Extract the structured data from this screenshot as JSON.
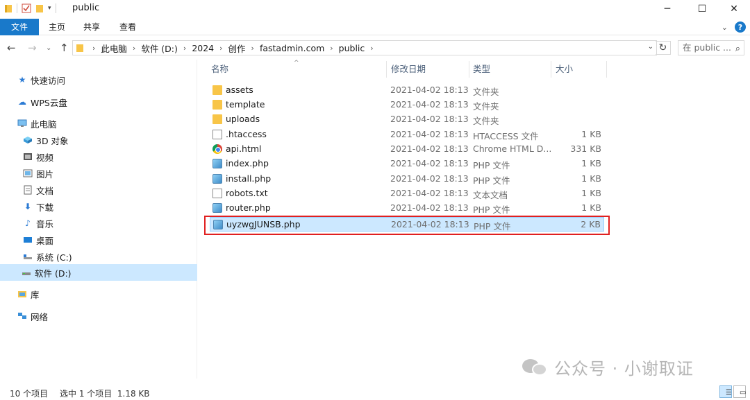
{
  "window": {
    "title": "public",
    "min_icon": "minimize-icon",
    "max_icon": "maximize-icon",
    "close_icon": "close-icon"
  },
  "ribbon": {
    "tabs": [
      "文件",
      "主页",
      "共享",
      "查看"
    ]
  },
  "address": {
    "crumbs": [
      "此电脑",
      "软件 (D:)",
      "2024",
      "创作",
      "fastadmin.com",
      "public"
    ],
    "search_placeholder": "在 public ..."
  },
  "sidebar": {
    "items": [
      {
        "label": "快速访问",
        "icon": "star-icon"
      },
      {
        "label": "WPS云盘",
        "icon": "cloud-icon"
      },
      {
        "label": "此电脑",
        "icon": "computer-icon"
      },
      {
        "label": "3D 对象",
        "icon": "cube-icon"
      },
      {
        "label": "视频",
        "icon": "video-icon"
      },
      {
        "label": "图片",
        "icon": "picture-icon"
      },
      {
        "label": "文档",
        "icon": "document-icon"
      },
      {
        "label": "下载",
        "icon": "download-icon"
      },
      {
        "label": "音乐",
        "icon": "music-icon"
      },
      {
        "label": "桌面",
        "icon": "desktop-icon"
      },
      {
        "label": "系统 (C:)",
        "icon": "drive-c-icon"
      },
      {
        "label": "软件 (D:)",
        "icon": "drive-d-icon"
      },
      {
        "label": "库",
        "icon": "library-icon"
      },
      {
        "label": "网络",
        "icon": "network-icon"
      }
    ]
  },
  "columns": {
    "name": "名称",
    "date": "修改日期",
    "type": "类型",
    "size": "大小"
  },
  "files": [
    {
      "name": "assets",
      "date": "2021-04-02 18:13",
      "type": "文件夹",
      "size": "",
      "kind": "folder"
    },
    {
      "name": "template",
      "date": "2021-04-02 18:13",
      "type": "文件夹",
      "size": "",
      "kind": "folder"
    },
    {
      "name": "uploads",
      "date": "2021-04-02 18:13",
      "type": "文件夹",
      "size": "",
      "kind": "folder"
    },
    {
      "name": ".htaccess",
      "date": "2021-04-02 18:13",
      "type": "HTACCESS 文件",
      "size": "1 KB",
      "kind": "doc"
    },
    {
      "name": "api.html",
      "date": "2021-04-02 18:13",
      "type": "Chrome HTML D...",
      "size": "331 KB",
      "kind": "chrome"
    },
    {
      "name": "index.php",
      "date": "2021-04-02 18:13",
      "type": "PHP 文件",
      "size": "1 KB",
      "kind": "php"
    },
    {
      "name": "install.php",
      "date": "2021-04-02 18:13",
      "type": "PHP 文件",
      "size": "1 KB",
      "kind": "php"
    },
    {
      "name": "robots.txt",
      "date": "2021-04-02 18:13",
      "type": "文本文档",
      "size": "1 KB",
      "kind": "doc"
    },
    {
      "name": "router.php",
      "date": "2021-04-02 18:13",
      "type": "PHP 文件",
      "size": "1 KB",
      "kind": "php"
    },
    {
      "name": "uyzwgJUNSB.php",
      "date": "2021-04-02 18:13",
      "type": "PHP 文件",
      "size": "2 KB",
      "kind": "php"
    }
  ],
  "status": {
    "count": "10 个项目",
    "selection": "选中 1 个项目  1.18 KB"
  },
  "watermark": {
    "text": "公众号 · 小谢取证"
  },
  "colors": {
    "accent": "#1979ca",
    "selection_bg": "#cce8ff",
    "highlight_border": "#e02020"
  }
}
